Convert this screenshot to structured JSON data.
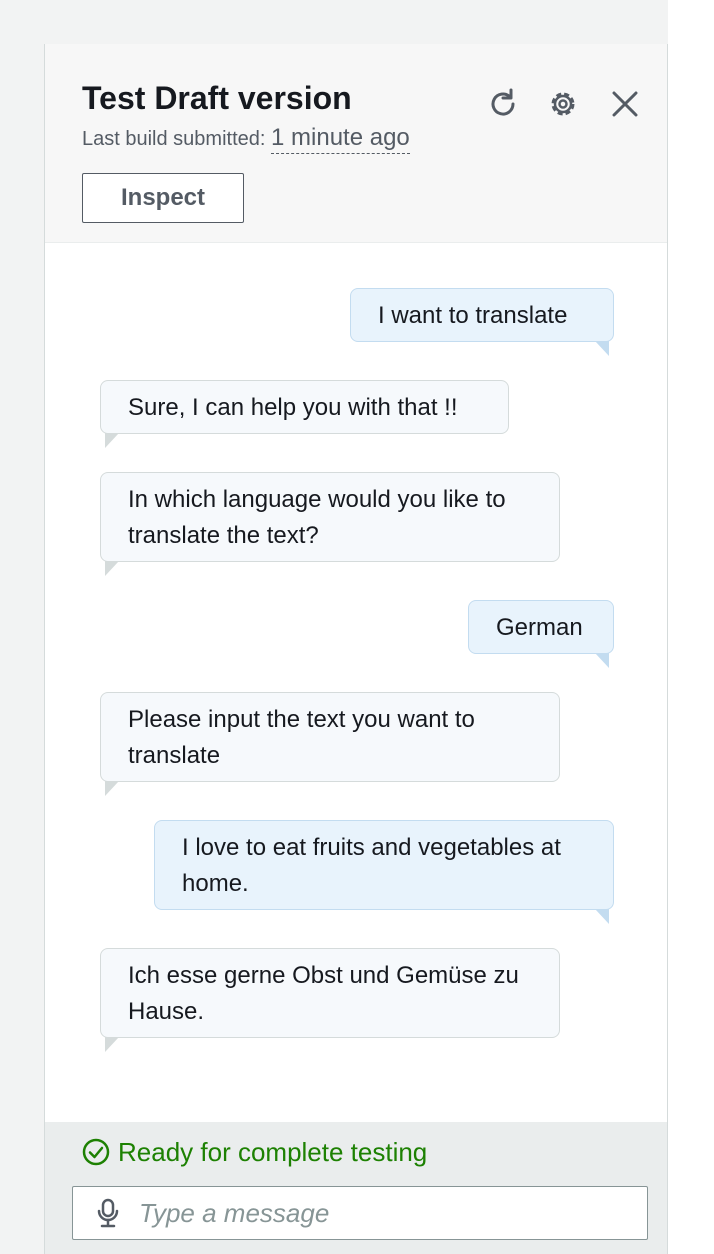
{
  "header": {
    "title": "Test Draft version",
    "subtitle_label": "Last build submitted:",
    "subtitle_time": "1 minute ago",
    "inspect_label": "Inspect"
  },
  "messages": [
    {
      "role": "user",
      "text": "I want to translate"
    },
    {
      "role": "bot",
      "text": "Sure, I can help you with that !!"
    },
    {
      "role": "bot",
      "text": "In which language would you like to translate the text?"
    },
    {
      "role": "user",
      "text": "German"
    },
    {
      "role": "bot",
      "text": "Please input the text you want to translate"
    },
    {
      "role": "user",
      "text": "I love to eat fruits and vegetables at home."
    },
    {
      "role": "bot",
      "text": "Ich esse gerne Obst und Gemüse zu Hause."
    }
  ],
  "footer": {
    "status": "Ready for complete testing",
    "input_placeholder": "Type a message"
  },
  "colors": {
    "status_green": "#1d8102",
    "user_bubble": "#e8f3fc",
    "bot_bubble": "#f6f9fc"
  },
  "icons": [
    "refresh-icon",
    "gear-icon",
    "close-icon",
    "check-circle-icon",
    "microphone-icon"
  ]
}
